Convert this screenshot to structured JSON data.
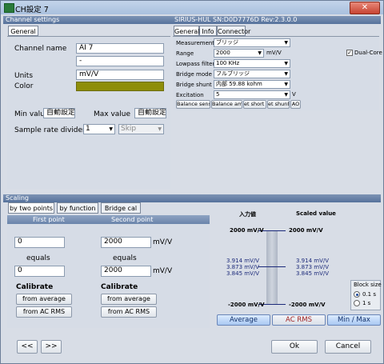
{
  "window": {
    "title": "CH設定 7",
    "close_glyph": "✕"
  },
  "channel_settings": {
    "header": "Channel settings",
    "device_info": "SIRIUS-HUL  SN:D0D7776D Rev:2.3.0.0",
    "left_tab": "General",
    "channel_name_label": "Channel name",
    "channel_name_value": "AI 7",
    "dash_value": "-",
    "units_label": "Units",
    "units_value": "mV/V",
    "color_label": "Color",
    "color_value": "#8e8e0a",
    "min_value_label": "Min value",
    "min_value_value": "自動設定",
    "max_value_label": "Max value",
    "max_value_value": "自動設定",
    "sample_rate_label": "Sample rate divider",
    "sample_rate_value": "1",
    "skip_value": "Skip"
  },
  "right_panel": {
    "tabs": [
      "General",
      "Info",
      "Connector"
    ],
    "measurement_label": "Measurement",
    "measurement_value": "ブリッジ",
    "range_label": "Range",
    "range_value": "2000",
    "range_unit": "mV/V",
    "dual_core_label": "Dual-Core",
    "dual_core_checked": "✓",
    "lowpass_label": "Lowpass filter",
    "lowpass_value": "100 KHz",
    "bridge_mode_label": "Bridge mode",
    "bridge_mode_value": "フルブリッジ",
    "bridge_shunt_label": "Bridge shunt",
    "bridge_shunt_value": "内部 59.88 kohm",
    "excitation_label": "Excitation",
    "excitation_value": "5",
    "excitation_unit": "V",
    "buttons": [
      "Balance sensor",
      "Balance ampl.",
      "et short c",
      "et shunt o",
      "AO"
    ]
  },
  "scaling": {
    "header": "Scaling",
    "tabs": [
      "by two points",
      "by function",
      "Bridge cal"
    ],
    "first_point_label": "First point",
    "second_point_label": "Second point",
    "first_input": "0",
    "first_output": "0",
    "second_input": "2000",
    "second_output": "2000",
    "unit": "mV/V",
    "equals_label": "equals",
    "calibrate_label": "Calibrate",
    "from_average": "from average",
    "from_ac_rms": "from AC RMS"
  },
  "meter": {
    "input_header": "入力値",
    "scaled_header": "Scaled value",
    "top_left": "2000 mV/V",
    "top_right": "2000 mV/V",
    "bottom_left": "-2000 mV/V",
    "bottom_right": "-2000 mV/V",
    "values_left": [
      "3.914 mV/V",
      "3.873 mV/V",
      "3.845 mV/V"
    ],
    "values_right": [
      "3.914 mV/V",
      "3.873 mV/V",
      "3.845 mV/V"
    ],
    "block_size_label": "Block size",
    "block_options": [
      "0.1 s",
      "1 s"
    ],
    "average_btn": "Average",
    "ac_rms_btn": "AC RMS",
    "min_max_btn": "Min / Max"
  },
  "footer": {
    "prev": "<<",
    "next": ">>",
    "ok": "Ok",
    "cancel": "Cancel"
  }
}
